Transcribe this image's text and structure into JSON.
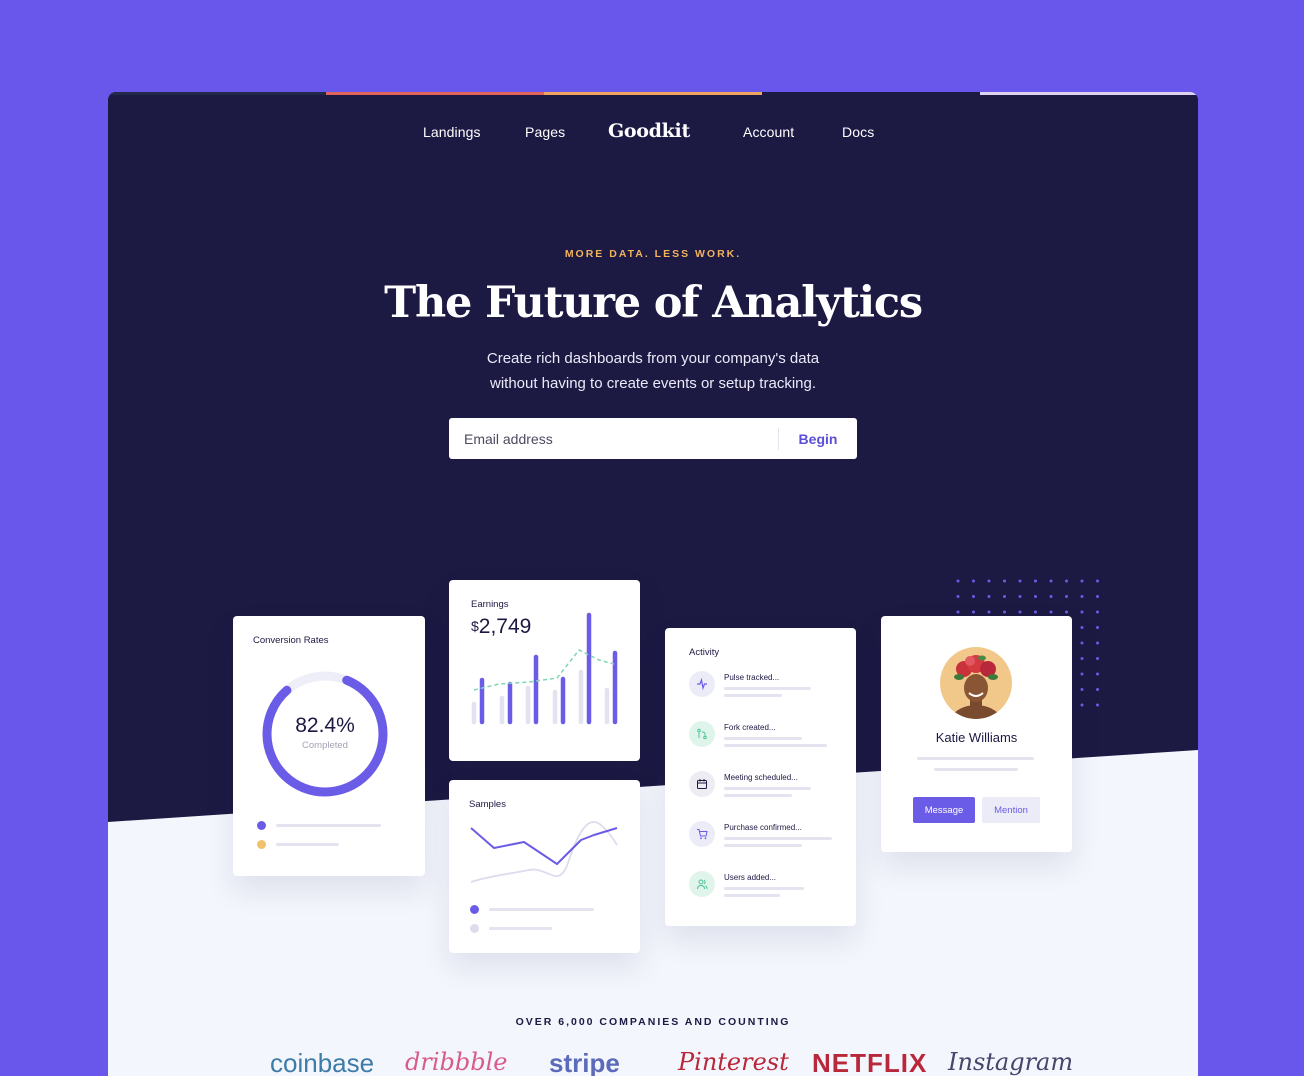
{
  "colors": {
    "brand": "#6857ea",
    "hero_bg": "#1c1943",
    "accent": "#5b4fd6",
    "eyebrow": "#f3b35b",
    "light_bg": "#f4f6fd",
    "topbar": [
      "#232a49",
      "#e0645c",
      "#f0a55e",
      "#1c1943",
      "#ded4f0"
    ]
  },
  "nav": {
    "items": [
      "Landings",
      "Pages",
      "Account",
      "Docs"
    ],
    "logo": "Goodkit"
  },
  "hero": {
    "eyebrow": "MORE DATA. LESS WORK.",
    "headline": "The Future of Analytics",
    "subtitle_line1": "Create rich dashboards from your company's data",
    "subtitle_line2": "without having to create events or setup tracking.",
    "email_placeholder": "Email address",
    "cta": "Begin"
  },
  "conversion_card": {
    "title": "Conversion Rates",
    "value": "82.4%",
    "value_fraction": 0.824,
    "caption": "Completed",
    "legend_colors": [
      "#6b5ce7",
      "#f3c06b"
    ]
  },
  "earnings_card": {
    "title": "Earnings",
    "currency": "$",
    "value": "2,749"
  },
  "samples_card": {
    "title": "Samples"
  },
  "activity_card": {
    "title": "Activity",
    "items": [
      {
        "label": "Pulse tracked...",
        "icon": "pulse-icon"
      },
      {
        "label": "Fork created...",
        "icon": "fork-icon"
      },
      {
        "label": "Meeting scheduled...",
        "icon": "calendar-icon"
      },
      {
        "label": "Purchase confirmed...",
        "icon": "cart-icon"
      },
      {
        "label": "Users added...",
        "icon": "users-icon"
      }
    ]
  },
  "profile_card": {
    "name": "Katie Williams",
    "message_label": "Message",
    "mention_label": "Mention"
  },
  "companies": {
    "heading": "OVER 6,000 COMPANIES AND COUNTING",
    "logos": [
      "coinbase",
      "dribbble",
      "stripe",
      "Pinterest",
      "NETFLIX",
      "Instagram"
    ]
  }
}
